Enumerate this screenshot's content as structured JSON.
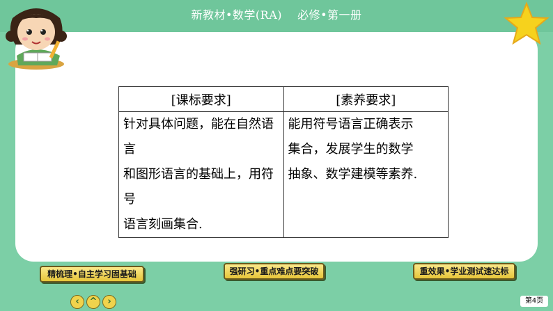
{
  "header": {
    "title": "新教材•数学(RA)　 必修•第一册"
  },
  "table": {
    "headers": [
      "[课标要求]",
      "[素养要求]"
    ],
    "rows": [
      [
        [
          "针对具体问题，能在自然语言",
          "和图形语言的基础上，用符号",
          "语言刻画集合."
        ],
        [
          "能用符号语言正确表示",
          "集合，发展学生的数学",
          "抽象、数学建模等素养."
        ]
      ]
    ]
  },
  "nav": {
    "left_label": "精梳理•自主学习固基础",
    "mid_label": "强研习•重点难点要突破",
    "right_label": "重效果•学业测试速达标",
    "prev_symbol": "‹",
    "home_symbol": "^",
    "next_symbol": "›"
  },
  "page": {
    "label": "第4页"
  },
  "colors": {
    "background": "#7ccfa6",
    "panel": "#ffffff",
    "button": "#f0d34c",
    "star": "#f6d21d"
  },
  "icons": [
    "girl-reading-icon",
    "star-icon",
    "prev-arrow-icon",
    "home-arrow-icon",
    "next-arrow-icon"
  ]
}
